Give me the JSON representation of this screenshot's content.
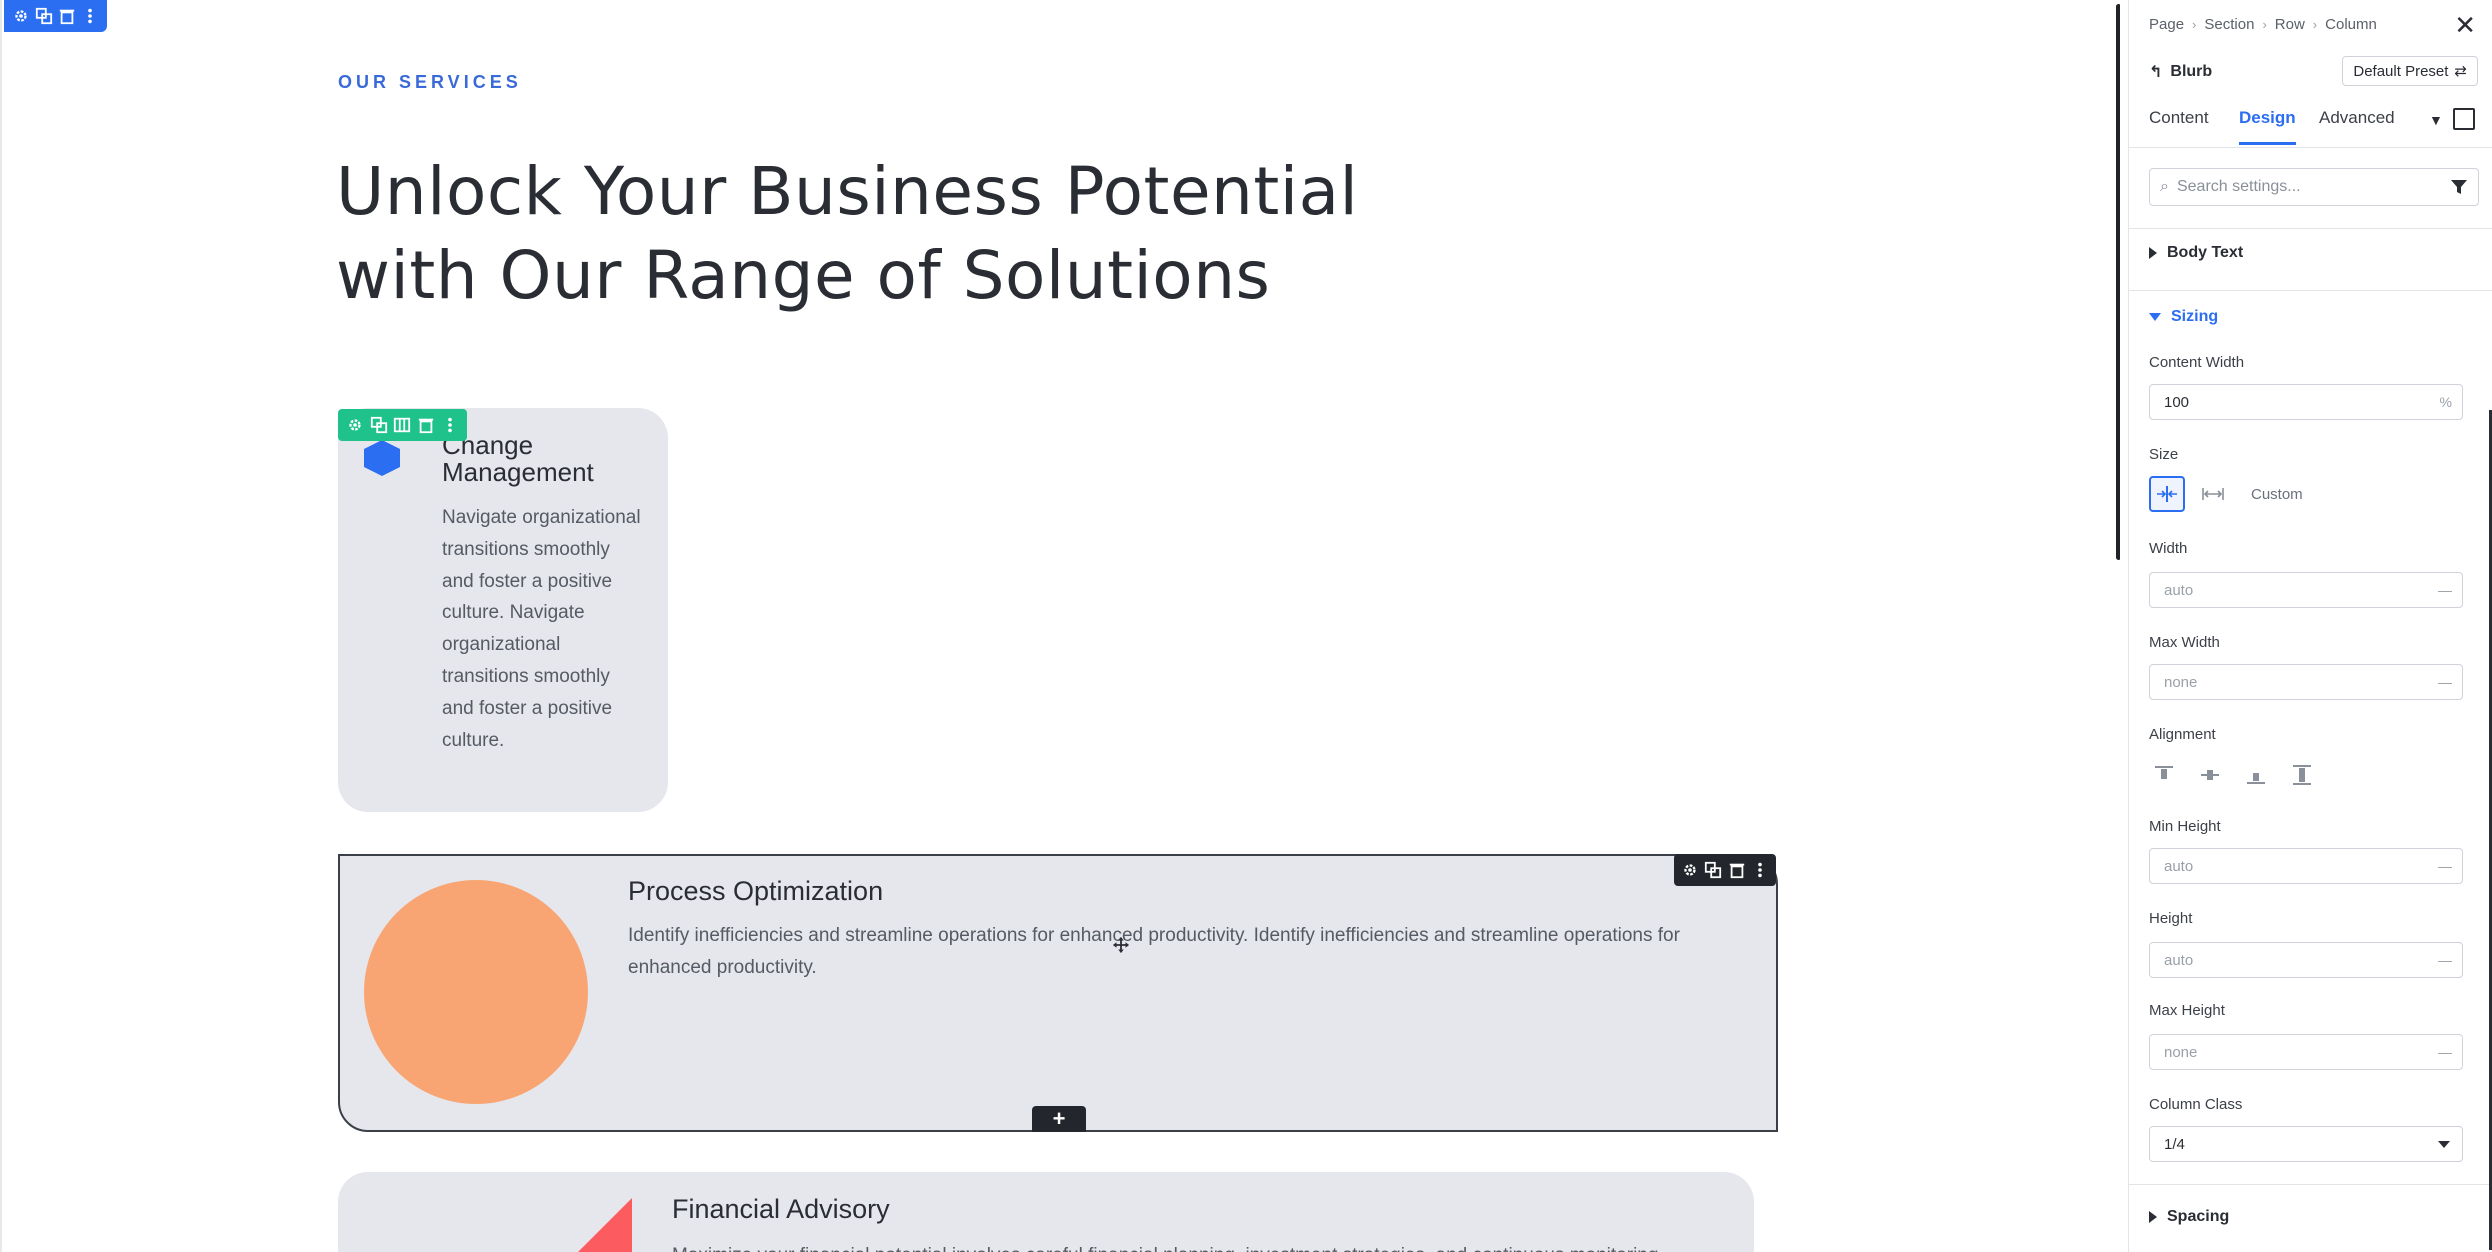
{
  "canvas": {
    "eyebrow": "OUR SERVICES",
    "headline_line1": "Unlock Your Business Potential",
    "headline_line2": "with Our Range of Solutions",
    "cards": [
      {
        "title": "Change Management",
        "body": "Navigate organizational transitions smoothly and foster a positive culture. Navigate organizational transitions smoothly and foster a positive culture.",
        "icon": "hexagon-icon",
        "icon_color": "#2b6ef2"
      },
      {
        "title": "Process Optimization",
        "body": "Identify inefficiencies and streamline operations for enhanced productivity. Identify inefficiencies and streamline operations for enhanced productivity.",
        "icon": "circle-icon",
        "icon_color": "#f9a573"
      },
      {
        "title": "Financial Advisory",
        "body": "Maximize your financial potential involves careful financial planning, investment strategies, and continuous monitoring",
        "icon": "triangle-icon",
        "icon_color": "#fc5b5f"
      }
    ],
    "add_label": "+",
    "colors": {
      "section_toolbar": "#2b6ef2",
      "module_toolbar": "#1fc28b",
      "dark_toolbar": "#23262c",
      "card_bg": "#e5e7ed"
    }
  },
  "panel": {
    "breadcrumb": [
      "Page",
      "Section",
      "Row",
      "Column"
    ],
    "module_name": "Blurb",
    "preset_label": "Default Preset",
    "tabs": [
      {
        "label": "Content"
      },
      {
        "label": "Design"
      },
      {
        "label": "Advanced"
      }
    ],
    "active_tab": "Design",
    "search_placeholder": "Search settings...",
    "groups": {
      "body_text": "Body Text",
      "sizing": "Sizing",
      "spacing": "Spacing"
    },
    "fields": {
      "content_width_label": "Content Width",
      "content_width_value": "100",
      "content_width_unit": "%",
      "size_label": "Size",
      "size_custom": "Custom",
      "width_label": "Width",
      "width_value": "auto",
      "max_width_label": "Max Width",
      "max_width_value": "none",
      "alignment_label": "Alignment",
      "min_height_label": "Min Height",
      "min_height_value": "auto",
      "height_label": "Height",
      "height_value": "auto",
      "max_height_label": "Max Height",
      "max_height_value": "none",
      "column_class_label": "Column Class",
      "column_class_value": "1/4",
      "dash": "—"
    },
    "accent": "#2b6ef2"
  }
}
